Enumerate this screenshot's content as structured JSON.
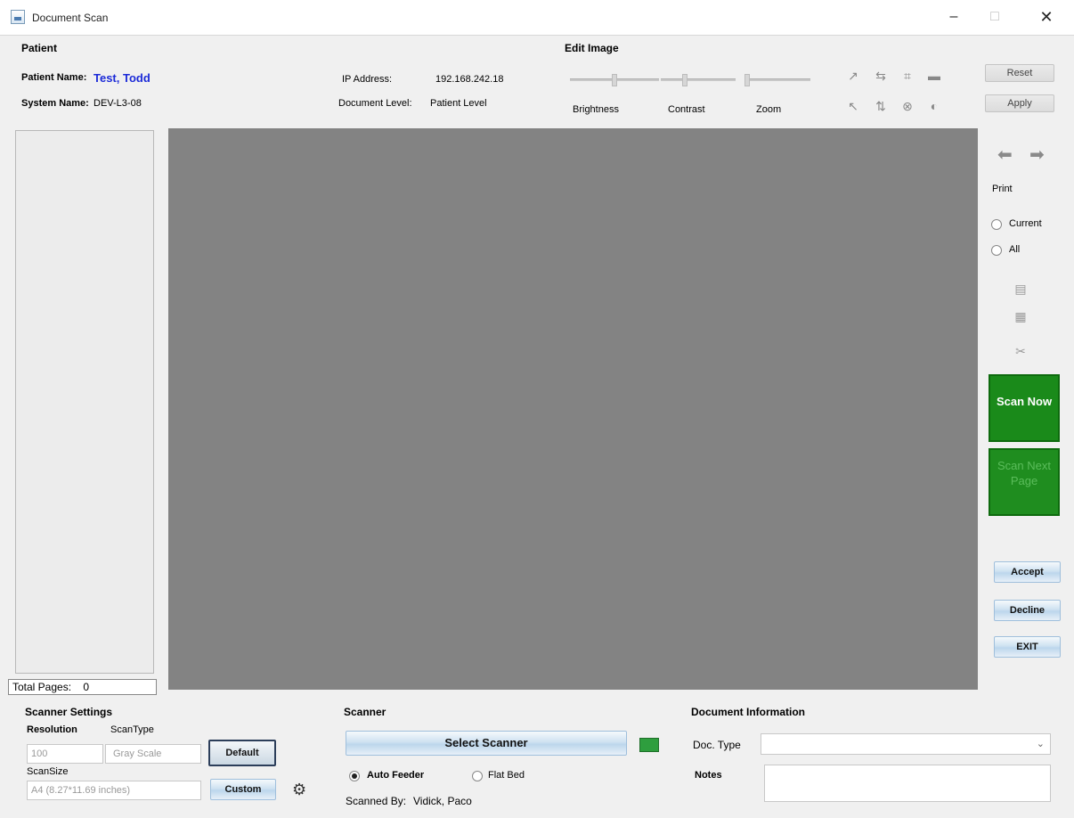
{
  "window": {
    "title": "Document Scan",
    "minimize": "–",
    "maximize": "□",
    "close": "✕"
  },
  "patient": {
    "section_title": "Patient",
    "name_label": "Patient Name:",
    "name_value": "Test, Todd",
    "system_label": "System Name:",
    "system_value": "DEV-L3-08",
    "ip_label": "IP Address:",
    "ip_value": "192.168.242.18",
    "doc_level_label": "Document Level:",
    "doc_level_value": "Patient Level"
  },
  "edit_image": {
    "section_title": "Edit Image",
    "brightness_label": "Brightness",
    "contrast_label": "Contrast",
    "zoom_label": "Zoom",
    "brightness_level": 0.5,
    "contrast_level": 0.5,
    "zoom_level": 0.0,
    "reset_label": "Reset",
    "apply_label": "Apply"
  },
  "thumbnails": {
    "total_pages_label": "Total Pages:",
    "total_pages_value": "0"
  },
  "right_panel": {
    "print_label": "Print",
    "current_label": "Current",
    "all_label": "All",
    "scan_now_label": "Scan Now",
    "scan_next_label": "Scan Next Page",
    "accept_label": "Accept",
    "decline_label": "Decline",
    "exit_label": "EXIT"
  },
  "scanner_settings": {
    "section_title": "Scanner Settings",
    "resolution_label": "Resolution",
    "scantype_label": "ScanType",
    "resolution_value": "100",
    "scantype_value": "Gray Scale",
    "scansize_label": "ScanSize",
    "scansize_value": "A4 (8.27*11.69 inches)",
    "default_label": "Default",
    "custom_label": "Custom"
  },
  "scanner": {
    "section_title": "Scanner",
    "select_label": "Select Scanner",
    "auto_feeder_label": "Auto Feeder",
    "flat_bed_label": "Flat Bed",
    "auto_feeder_selected": true,
    "scanned_by_label": "Scanned By:",
    "scanned_by_value": "Vidick, Paco"
  },
  "document_info": {
    "section_title": "Document Information",
    "doc_type_label": "Doc. Type",
    "doc_type_value": "",
    "notes_label": "Notes",
    "notes_value": ""
  },
  "colors": {
    "accent_green": "#1a8a1a",
    "name_blue": "#1c2bd8",
    "preview_gray": "#838383"
  }
}
